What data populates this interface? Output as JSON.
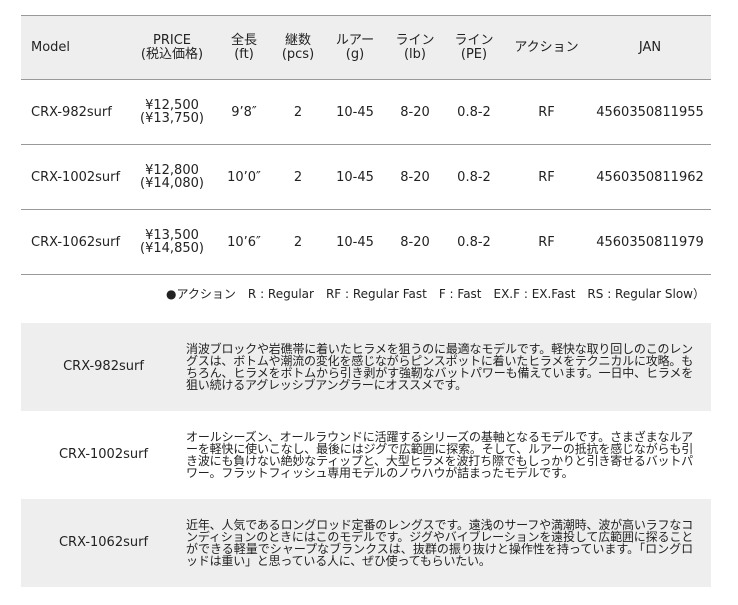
{
  "headers": [
    {
      "line1": "Model",
      "line2": ""
    },
    {
      "line1": "PRICE",
      "line2": "(税込価格)"
    },
    {
      "line1": "全長",
      "line2": "(ft)"
    },
    {
      "line1": "継数",
      "line2": "(pcs)"
    },
    {
      "line1": "ルアー",
      "line2": "(g)"
    },
    {
      "line1": "ライン",
      "line2": "(lb)"
    },
    {
      "line1": "ライン",
      "line2": "(PE)"
    },
    {
      "line1": "アクション",
      "line2": ""
    },
    {
      "line1": "JAN",
      "line2": ""
    }
  ],
  "rows": [
    {
      "model": "CRX-982surf",
      "price": "¥12,500",
      "price_tax": "(¥13,750)",
      "length": "9’8″",
      "pcs": "2",
      "lure": "10-45",
      "line_lb": "8-20",
      "line_pe": "0.8-2",
      "action": "RF",
      "jan": "4560350811955"
    },
    {
      "model": "CRX-1002surf",
      "price": "¥12,800",
      "price_tax": "(¥14,080)",
      "length": "10’0″",
      "pcs": "2",
      "lure": "10-45",
      "line_lb": "8-20",
      "line_pe": "0.8-2",
      "action": "RF",
      "jan": "4560350811962"
    },
    {
      "model": "CRX-1062surf",
      "price": "¥13,500",
      "price_tax": "(¥14,850)",
      "length": "10’6″",
      "pcs": "2",
      "lure": "10-45",
      "line_lb": "8-20",
      "line_pe": "0.8-2",
      "action": "RF",
      "jan": "4560350811979"
    }
  ],
  "legend": "●アクション　R : Regular　RF : Regular Fast　F : Fast　EX.F : EX.Fast　RS : Regular Slow）",
  "descriptions": [
    {
      "model": "CRX-982surf",
      "text": "消波ブロックや岩礁帯に着いたヒラメを狙うのに最適なモデルです。軽快な取り回しのこのレングスは、ボトムや潮流の変化を感じながらピンスポットに着いたヒラメをテクニカルに攻略。もちろん、ヒラメをボトムから引き剥がす強靭なバットパワーも備えています。一日中、ヒラメを狙い続けるアグレッシブアングラーにオススメです。"
    },
    {
      "model": "CRX-1002surf",
      "text": "オールシーズン、オールラウンドに活躍するシリーズの基軸となるモデルです。さまざまなルアーを軽快に使いこなし、最後にはジグで広範囲に探索。そして、ルアーの抵抗を感じながらも引き波にも負けない絶妙なティップと、大型ヒラメを波打ち際でもしっかりと引き寄せるバットパワー。フラットフィッシュ専用モデルのノウハウが詰まったモデルです。"
    },
    {
      "model": "CRX-1062surf",
      "text": "近年、人気であるロングロッド定番のレングスです。遠浅のサーフや満潮時、波が高いラフなコンディションのときにはこのモデルです。ジグやバイブレーションを遠投して広範囲に探ることができる軽量でシャープなブランクスは、抜群の振り抜けと操作性を持っています。「ロングロッドは重い」と思っている人に、ぜひ使ってもらいたい。"
    }
  ]
}
